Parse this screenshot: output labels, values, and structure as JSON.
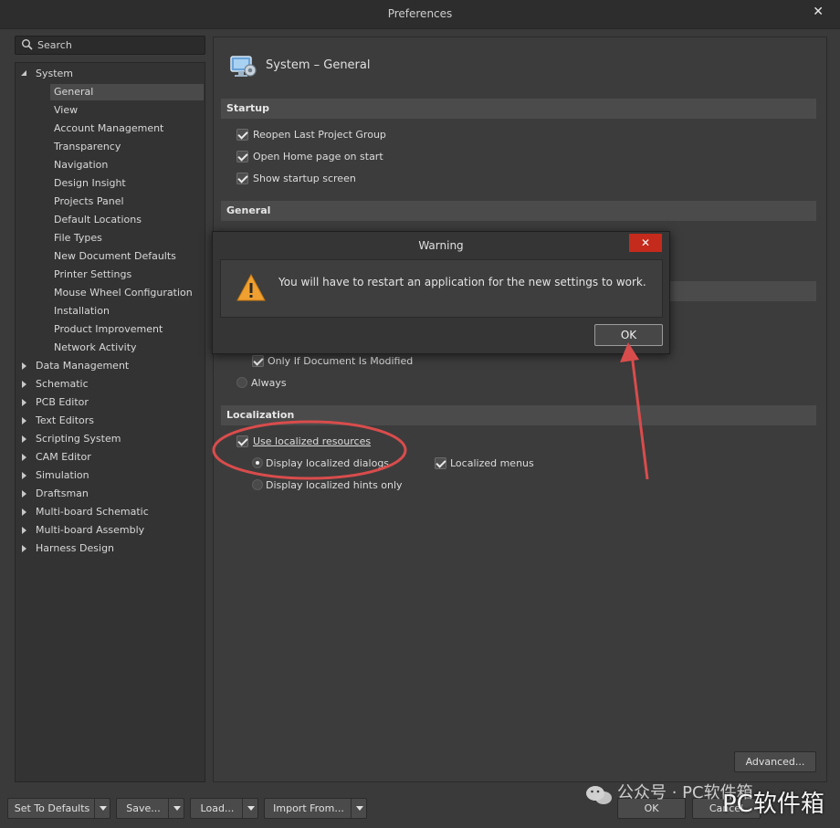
{
  "window": {
    "title": "Preferences",
    "close_glyph": "✕"
  },
  "search": {
    "placeholder": "Search",
    "icon": "search-icon"
  },
  "tree": {
    "system": {
      "label": "System",
      "expanded": true
    },
    "system_children": [
      "General",
      "View",
      "Account Management",
      "Transparency",
      "Navigation",
      "Design Insight",
      "Projects Panel",
      "Default Locations",
      "File Types",
      "New Document Defaults",
      "Printer Settings",
      "Mouse Wheel Configuration",
      "Installation",
      "Product Improvement",
      "Network Activity"
    ],
    "selected": "General",
    "groups": [
      "Data Management",
      "Schematic",
      "PCB Editor",
      "Text Editors",
      "Scripting System",
      "CAM Editor",
      "Simulation",
      "Draftsman",
      "Multi-board Schematic",
      "Multi-board Assembly",
      "Harness Design"
    ]
  },
  "panel": {
    "title": "System – General",
    "icon": "system-monitor-icon",
    "startup": {
      "header": "Startup",
      "options": [
        "Reopen Last Project Group",
        "Open Home page on start",
        "Show startup screen"
      ]
    },
    "general": {
      "header": "General"
    },
    "only_if_modified": "Only If Document Is Modified",
    "always": "Always",
    "localization": {
      "header": "Localization",
      "use_localized": "Use localized resources",
      "display_dialogs": "Display localized dialogs",
      "display_hints": "Display localized hints only",
      "localized_menus": "Localized menus"
    },
    "advanced_button": "Advanced..."
  },
  "dialog": {
    "title": "Warning",
    "close_glyph": "✕",
    "message": "You will have to restart an application for the new settings to work.",
    "ok": "OK",
    "icon": "warning-icon"
  },
  "footer": {
    "set_to_defaults": "Set To Defaults",
    "save": "Save...",
    "load": "Load...",
    "import_from": "Import From...",
    "ok": "OK",
    "cancel": "Cancel"
  },
  "annotations": {
    "color": "#d94c4c"
  },
  "watermark": {
    "text": "公众号 · PC软件箱",
    "overlay_text": "PC软件箱"
  }
}
